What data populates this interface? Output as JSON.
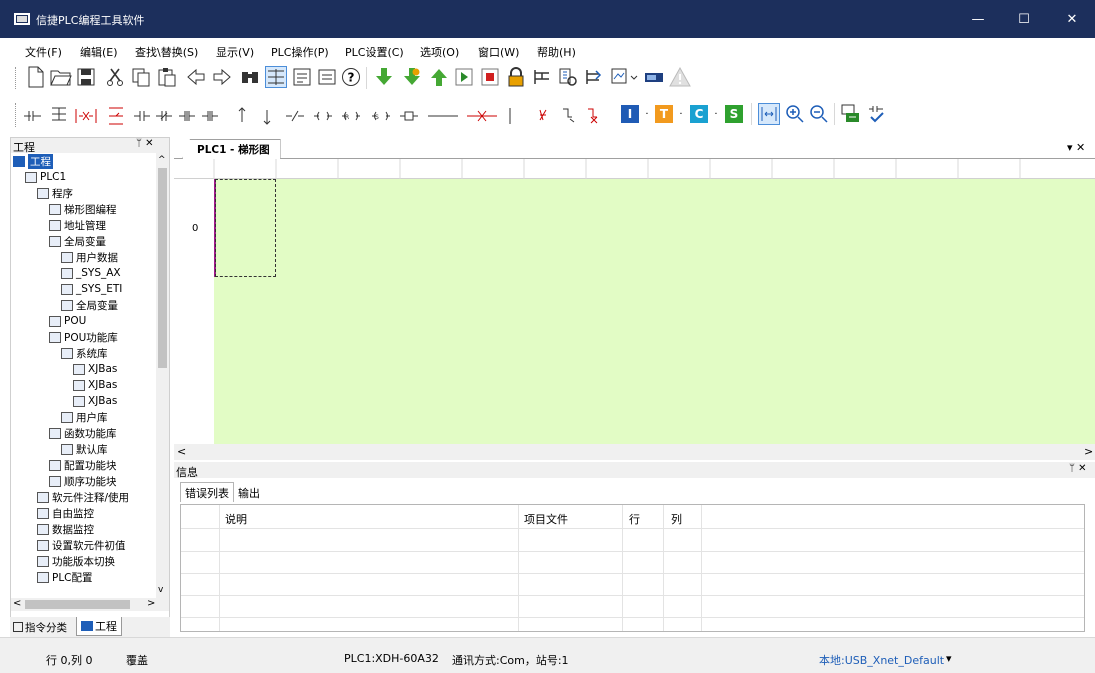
{
  "window": {
    "title": "信捷PLC编程工具软件",
    "minimize": "—",
    "maximize": "☐",
    "close": "✕"
  },
  "menu": [
    "文件(F)",
    "编辑(E)",
    "查找\\替换(S)",
    "显示(V)",
    "PLC操作(P)",
    "PLC设置(C)",
    "选项(O)",
    "窗口(W)",
    "帮助(H)"
  ],
  "toolbar1_icons": [
    "new-file-icon",
    "open-folder-icon",
    "save-icon",
    "cut-icon",
    "copy-icon",
    "paste-icon",
    "back-arrow-icon",
    "forward-arrow-icon",
    "find-icon",
    "ladder-view-icon",
    "instruction-view-icon",
    "list-view-icon",
    "help-icon",
    "download-icon",
    "upload-icon",
    "up-arrow-icon",
    "run-icon",
    "stop-icon",
    "lock-icon",
    "monitor-icon",
    "compare-icon",
    "settings-icon",
    "comm-icon",
    "device-icon",
    "warning-icon"
  ],
  "toolbar2_labels": {
    "contact_no": "⊣⊢",
    "set_s": "S",
    "set_i": "I",
    "set_t": "T",
    "set_c": "C"
  },
  "left_pane": {
    "title": "工程",
    "pin": "ᛘ ✕",
    "tree": [
      {
        "label": "工程",
        "level": 0,
        "icon": "project-icon",
        "selected": true
      },
      {
        "label": "PLC1",
        "level": 1,
        "icon": "plc-icon"
      },
      {
        "label": "程序",
        "level": 2,
        "icon": "program-icon"
      },
      {
        "label": "梯形图编程",
        "level": 3,
        "icon": "ladder-icon"
      },
      {
        "label": "地址管理",
        "level": 3,
        "icon": "address-icon"
      },
      {
        "label": "全局变量",
        "level": 3,
        "icon": "global-var-icon"
      },
      {
        "label": "用户数据",
        "level": 4,
        "icon": "user-data-icon"
      },
      {
        "label": "_SYS_AX",
        "level": 4,
        "icon": "globe-icon"
      },
      {
        "label": "_SYS_ETI",
        "level": 4,
        "icon": "globe-icon"
      },
      {
        "label": "全局变量",
        "level": 4,
        "icon": "globe-icon"
      },
      {
        "label": "POU",
        "level": 3,
        "icon": "pou-icon"
      },
      {
        "label": "POU功能库",
        "level": 3,
        "icon": "pou-lib-icon"
      },
      {
        "label": "系统库",
        "level": 4,
        "icon": "system-lib-icon"
      },
      {
        "label": "XJBas",
        "level": 5,
        "icon": "db-icon"
      },
      {
        "label": "XJBas",
        "level": 5,
        "icon": "db-icon"
      },
      {
        "label": "XJBas",
        "level": 5,
        "icon": "db-icon"
      },
      {
        "label": "用户库",
        "level": 4,
        "icon": "user-lib-icon"
      },
      {
        "label": "函数功能库",
        "level": 3,
        "icon": "func-lib-icon"
      },
      {
        "label": "默认库",
        "level": 4,
        "icon": "default-lib-icon"
      },
      {
        "label": "配置功能块",
        "level": 3,
        "icon": "config-fb-icon"
      },
      {
        "label": "顺序功能块",
        "level": 3,
        "icon": "sequence-fb-icon"
      },
      {
        "label": "软元件注释/使用",
        "level": 2,
        "icon": "comment-icon"
      },
      {
        "label": "自由监控",
        "level": 2,
        "icon": "free-monitor-icon"
      },
      {
        "label": "数据监控",
        "level": 2,
        "icon": "data-monitor-icon"
      },
      {
        "label": "设置软元件初值",
        "level": 2,
        "icon": "init-value-icon"
      },
      {
        "label": "功能版本切换",
        "level": 2,
        "icon": "version-icon"
      },
      {
        "label": "PLC配置",
        "level": 2,
        "icon": "plc-config-icon"
      }
    ],
    "bottom_tabs": [
      "指令分类",
      "工程"
    ]
  },
  "doc_tab": {
    "label": "PLC1 - 梯形图",
    "close": "▾ ✕"
  },
  "ladder": {
    "row_number": "0"
  },
  "info_pane": {
    "title": "信息",
    "pin": "ᛘ ✕",
    "tabs": [
      "错误列表",
      "输出"
    ],
    "columns": [
      "说明",
      "项目文件",
      "行",
      "列"
    ]
  },
  "status": {
    "position": "行 0,列 0",
    "mode": "覆盖",
    "plc_info": "PLC1:XDH-60A32",
    "comm": "通讯方式:Com，站号:1",
    "connection": "本地:USB_Xnet_Default",
    "dropdown": "▾"
  },
  "colors": {
    "titlebar": "#1c2f5c",
    "ladder_bg": "#e2fcc5",
    "accent_blue": "#1e5eb8",
    "green": "#3a9d2a"
  }
}
